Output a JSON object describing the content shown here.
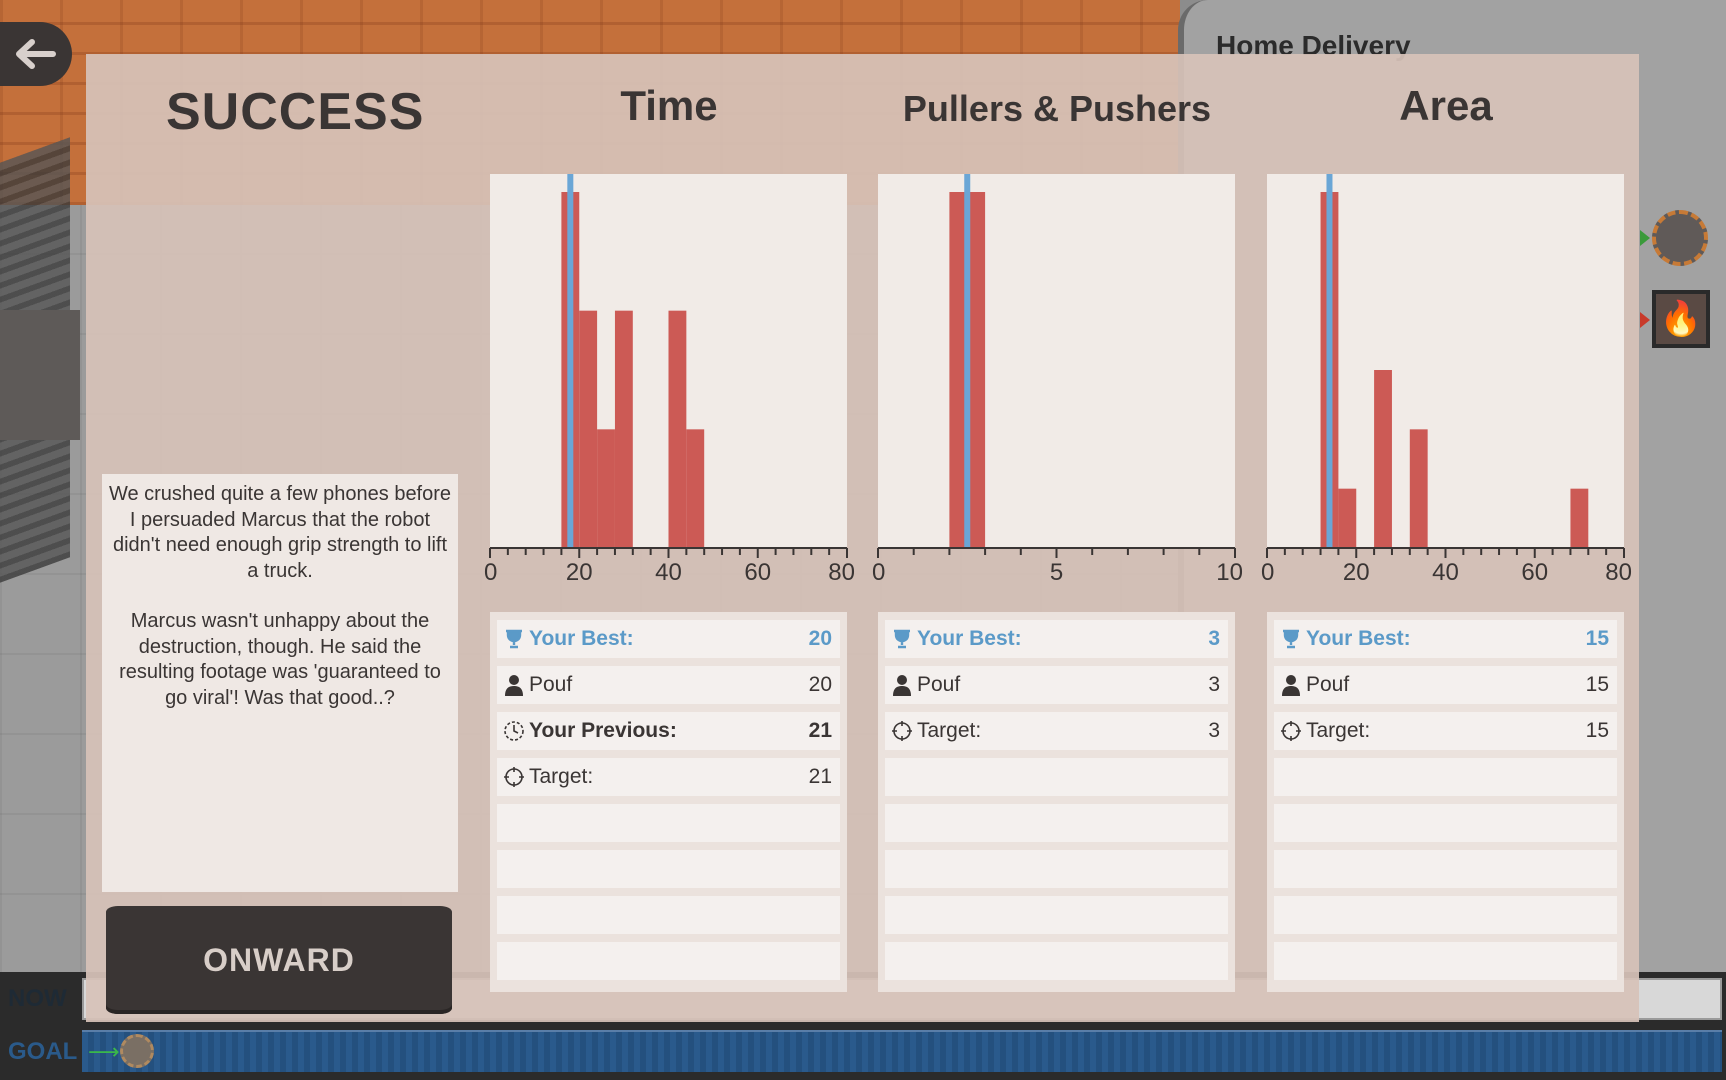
{
  "background": {
    "panel_title": "Home Delivery"
  },
  "timeline": {
    "now_label": "NOW",
    "goal_label": "GOAL"
  },
  "result": {
    "title": "SUCCESS",
    "story_paragraphs": [
      "We crushed quite a few phones before I persuaded Marcus that the robot didn't need enough grip strength to lift a truck.",
      "Marcus wasn't unhappy about the destruction, though. He said the resulting footage was 'guaranteed to go viral'! Was that good..?"
    ],
    "onward_label": "ONWARD"
  },
  "colors": {
    "bar": "#cc5a55",
    "marker": "#6aa6d6",
    "best_text": "#5b9ac8",
    "dark": "#3a3534"
  },
  "columns": [
    {
      "title": "Time",
      "scores": [
        {
          "icon": "trophy-icon",
          "label": "Your Best:",
          "value": "20",
          "style": "best"
        },
        {
          "icon": "person-icon",
          "label": "Pouf",
          "value": "20",
          "style": "normal"
        },
        {
          "icon": "clock-icon",
          "label": "Your Previous:",
          "value": "21",
          "style": "prev"
        },
        {
          "icon": "target-icon",
          "label": "Target:",
          "value": "21",
          "style": "normal"
        }
      ]
    },
    {
      "title": "Pullers & Pushers",
      "scores": [
        {
          "icon": "trophy-icon",
          "label": "Your Best:",
          "value": "3",
          "style": "best"
        },
        {
          "icon": "person-icon",
          "label": "Pouf",
          "value": "3",
          "style": "normal"
        },
        {
          "icon": "target-icon",
          "label": "Target:",
          "value": "3",
          "style": "normal"
        }
      ]
    },
    {
      "title": "Area",
      "scores": [
        {
          "icon": "trophy-icon",
          "label": "Your Best:",
          "value": "15",
          "style": "best"
        },
        {
          "icon": "person-icon",
          "label": "Pouf",
          "value": "15",
          "style": "normal"
        },
        {
          "icon": "target-icon",
          "label": "Target:",
          "value": "15",
          "style": "normal"
        }
      ]
    }
  ],
  "chart_data": [
    {
      "type": "bar",
      "title": "Time",
      "xlim": [
        0,
        80
      ],
      "ylim": [
        0,
        6
      ],
      "xticks": [
        0,
        20,
        40,
        60,
        80
      ],
      "minor_tick_step": 4,
      "bin_width": 4,
      "bins": [
        {
          "x": 16,
          "value": 6
        },
        {
          "x": 20,
          "value": 4
        },
        {
          "x": 24,
          "value": 2
        },
        {
          "x": 28,
          "value": 4
        },
        {
          "x": 40,
          "value": 4
        },
        {
          "x": 44,
          "value": 2
        }
      ],
      "marker": 18
    },
    {
      "type": "bar",
      "title": "Pullers & Pushers",
      "xlim": [
        0,
        10
      ],
      "ylim": [
        0,
        6
      ],
      "xticks": [
        0,
        5,
        10
      ],
      "minor_tick_step": 1,
      "bin_width": 1,
      "bins": [
        {
          "x": 2,
          "value": 6
        }
      ],
      "marker": 2.5
    },
    {
      "type": "bar",
      "title": "Area",
      "xlim": [
        0,
        80
      ],
      "ylim": [
        0,
        6
      ],
      "xticks": [
        0,
        20,
        40,
        60,
        80
      ],
      "minor_tick_step": 4,
      "bin_width": 4,
      "bins": [
        {
          "x": 12,
          "value": 6
        },
        {
          "x": 16,
          "value": 1
        },
        {
          "x": 24,
          "value": 3
        },
        {
          "x": 32,
          "value": 2
        },
        {
          "x": 68,
          "value": 1
        }
      ],
      "marker": 14
    }
  ]
}
